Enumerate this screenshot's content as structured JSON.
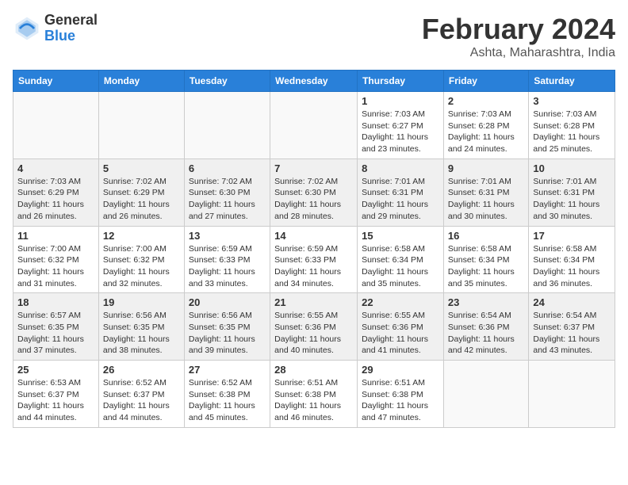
{
  "logo": {
    "general": "General",
    "blue": "Blue"
  },
  "title": {
    "month_year": "February 2024",
    "location": "Ashta, Maharashtra, India"
  },
  "headers": [
    "Sunday",
    "Monday",
    "Tuesday",
    "Wednesday",
    "Thursday",
    "Friday",
    "Saturday"
  ],
  "weeks": [
    [
      {
        "day": "",
        "detail": ""
      },
      {
        "day": "",
        "detail": ""
      },
      {
        "day": "",
        "detail": ""
      },
      {
        "day": "",
        "detail": ""
      },
      {
        "day": "1",
        "detail": "Sunrise: 7:03 AM\nSunset: 6:27 PM\nDaylight: 11 hours\nand 23 minutes."
      },
      {
        "day": "2",
        "detail": "Sunrise: 7:03 AM\nSunset: 6:28 PM\nDaylight: 11 hours\nand 24 minutes."
      },
      {
        "day": "3",
        "detail": "Sunrise: 7:03 AM\nSunset: 6:28 PM\nDaylight: 11 hours\nand 25 minutes."
      }
    ],
    [
      {
        "day": "4",
        "detail": "Sunrise: 7:03 AM\nSunset: 6:29 PM\nDaylight: 11 hours\nand 26 minutes."
      },
      {
        "day": "5",
        "detail": "Sunrise: 7:02 AM\nSunset: 6:29 PM\nDaylight: 11 hours\nand 26 minutes."
      },
      {
        "day": "6",
        "detail": "Sunrise: 7:02 AM\nSunset: 6:30 PM\nDaylight: 11 hours\nand 27 minutes."
      },
      {
        "day": "7",
        "detail": "Sunrise: 7:02 AM\nSunset: 6:30 PM\nDaylight: 11 hours\nand 28 minutes."
      },
      {
        "day": "8",
        "detail": "Sunrise: 7:01 AM\nSunset: 6:31 PM\nDaylight: 11 hours\nand 29 minutes."
      },
      {
        "day": "9",
        "detail": "Sunrise: 7:01 AM\nSunset: 6:31 PM\nDaylight: 11 hours\nand 30 minutes."
      },
      {
        "day": "10",
        "detail": "Sunrise: 7:01 AM\nSunset: 6:31 PM\nDaylight: 11 hours\nand 30 minutes."
      }
    ],
    [
      {
        "day": "11",
        "detail": "Sunrise: 7:00 AM\nSunset: 6:32 PM\nDaylight: 11 hours\nand 31 minutes."
      },
      {
        "day": "12",
        "detail": "Sunrise: 7:00 AM\nSunset: 6:32 PM\nDaylight: 11 hours\nand 32 minutes."
      },
      {
        "day": "13",
        "detail": "Sunrise: 6:59 AM\nSunset: 6:33 PM\nDaylight: 11 hours\nand 33 minutes."
      },
      {
        "day": "14",
        "detail": "Sunrise: 6:59 AM\nSunset: 6:33 PM\nDaylight: 11 hours\nand 34 minutes."
      },
      {
        "day": "15",
        "detail": "Sunrise: 6:58 AM\nSunset: 6:34 PM\nDaylight: 11 hours\nand 35 minutes."
      },
      {
        "day": "16",
        "detail": "Sunrise: 6:58 AM\nSunset: 6:34 PM\nDaylight: 11 hours\nand 35 minutes."
      },
      {
        "day": "17",
        "detail": "Sunrise: 6:58 AM\nSunset: 6:34 PM\nDaylight: 11 hours\nand 36 minutes."
      }
    ],
    [
      {
        "day": "18",
        "detail": "Sunrise: 6:57 AM\nSunset: 6:35 PM\nDaylight: 11 hours\nand 37 minutes."
      },
      {
        "day": "19",
        "detail": "Sunrise: 6:56 AM\nSunset: 6:35 PM\nDaylight: 11 hours\nand 38 minutes."
      },
      {
        "day": "20",
        "detail": "Sunrise: 6:56 AM\nSunset: 6:35 PM\nDaylight: 11 hours\nand 39 minutes."
      },
      {
        "day": "21",
        "detail": "Sunrise: 6:55 AM\nSunset: 6:36 PM\nDaylight: 11 hours\nand 40 minutes."
      },
      {
        "day": "22",
        "detail": "Sunrise: 6:55 AM\nSunset: 6:36 PM\nDaylight: 11 hours\nand 41 minutes."
      },
      {
        "day": "23",
        "detail": "Sunrise: 6:54 AM\nSunset: 6:36 PM\nDaylight: 11 hours\nand 42 minutes."
      },
      {
        "day": "24",
        "detail": "Sunrise: 6:54 AM\nSunset: 6:37 PM\nDaylight: 11 hours\nand 43 minutes."
      }
    ],
    [
      {
        "day": "25",
        "detail": "Sunrise: 6:53 AM\nSunset: 6:37 PM\nDaylight: 11 hours\nand 44 minutes."
      },
      {
        "day": "26",
        "detail": "Sunrise: 6:52 AM\nSunset: 6:37 PM\nDaylight: 11 hours\nand 44 minutes."
      },
      {
        "day": "27",
        "detail": "Sunrise: 6:52 AM\nSunset: 6:38 PM\nDaylight: 11 hours\nand 45 minutes."
      },
      {
        "day": "28",
        "detail": "Sunrise: 6:51 AM\nSunset: 6:38 PM\nDaylight: 11 hours\nand 46 minutes."
      },
      {
        "day": "29",
        "detail": "Sunrise: 6:51 AM\nSunset: 6:38 PM\nDaylight: 11 hours\nand 47 minutes."
      },
      {
        "day": "",
        "detail": ""
      },
      {
        "day": "",
        "detail": ""
      }
    ]
  ]
}
